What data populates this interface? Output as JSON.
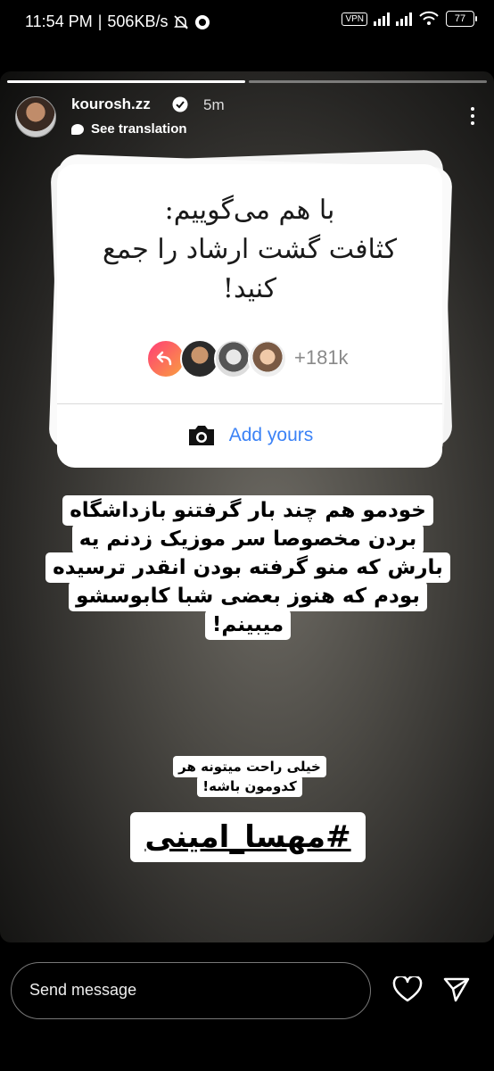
{
  "status_bar": {
    "time": "11:54 PM",
    "separator": "|",
    "network_speed": "506KB/s",
    "vpn": "VPN",
    "battery": "77"
  },
  "story": {
    "username": "kourosh.zz",
    "verified": true,
    "time_ago": "5m",
    "see_translation": "See translation",
    "add_yours_card": {
      "prompt_lines": [
        "با هم می‌گوییم:",
        "کثافت گشت ارشاد را جمع",
        "کنید!"
      ],
      "participants_count": "+181k",
      "button_label": "Add yours"
    },
    "caption_lines": [
      "خودمو هم چند بار گرفتنو بازداشگاه",
      "بردن مخصوصا سر موزیک زدنم یه",
      "بارش که منو گرفته بودن  انقدر ترسیده",
      "بودم که هنوز بعضی شبا کابوسشو",
      "میبینم!"
    ],
    "small_caption_lines": [
      "خیلی راحت میتونه هر",
      "کدومون باشه!"
    ],
    "hashtag": "#مهسا_امینی"
  },
  "reply_bar": {
    "placeholder": "Send message"
  },
  "colors": {
    "link_blue": "#3b82f6",
    "background": "#000000"
  }
}
